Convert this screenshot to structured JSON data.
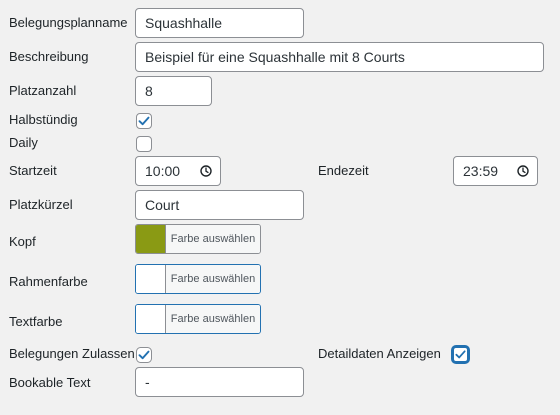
{
  "form": {
    "plan_name": {
      "label": "Belegungsplanname",
      "value": "Squashhalle"
    },
    "description": {
      "label": "Beschreibung",
      "value": "Beispiel für eine Squashhalle mit 8 Courts"
    },
    "court_count": {
      "label": "Platzanzahl",
      "value": "8"
    },
    "half_hourly": {
      "label": "Halbstündig",
      "checked": true
    },
    "daily": {
      "label": "Daily",
      "checked": false
    },
    "start_time": {
      "label": "Startzeit",
      "value": "10:00"
    },
    "end_time": {
      "label": "Endezeit",
      "value": "23:59"
    },
    "court_abbrev": {
      "label": "Platzkürzel",
      "value": "Court"
    },
    "header_color": {
      "label": "Kopf",
      "button": "Farbe auswählen",
      "color": "#8a9a14"
    },
    "border_color": {
      "label": "Rahmenfarbe",
      "button": "Farbe auswählen",
      "color": "#ffffff"
    },
    "text_color": {
      "label": "Textfarbe",
      "button": "Farbe auswählen",
      "color": "#ffffff"
    },
    "allow_bookings": {
      "label": "Belegungen Zulassen",
      "checked": true
    },
    "show_details": {
      "label": "Detaildaten Anzeigen",
      "checked": true
    },
    "bookable_text": {
      "label": "Bookable Text",
      "value": "-"
    }
  },
  "colors": {
    "accent": "#2271b1",
    "border": "#8c8f94",
    "background": "#f1f1f1"
  },
  "icons": {
    "clock": "clock-icon",
    "check": "checkmark-icon"
  }
}
